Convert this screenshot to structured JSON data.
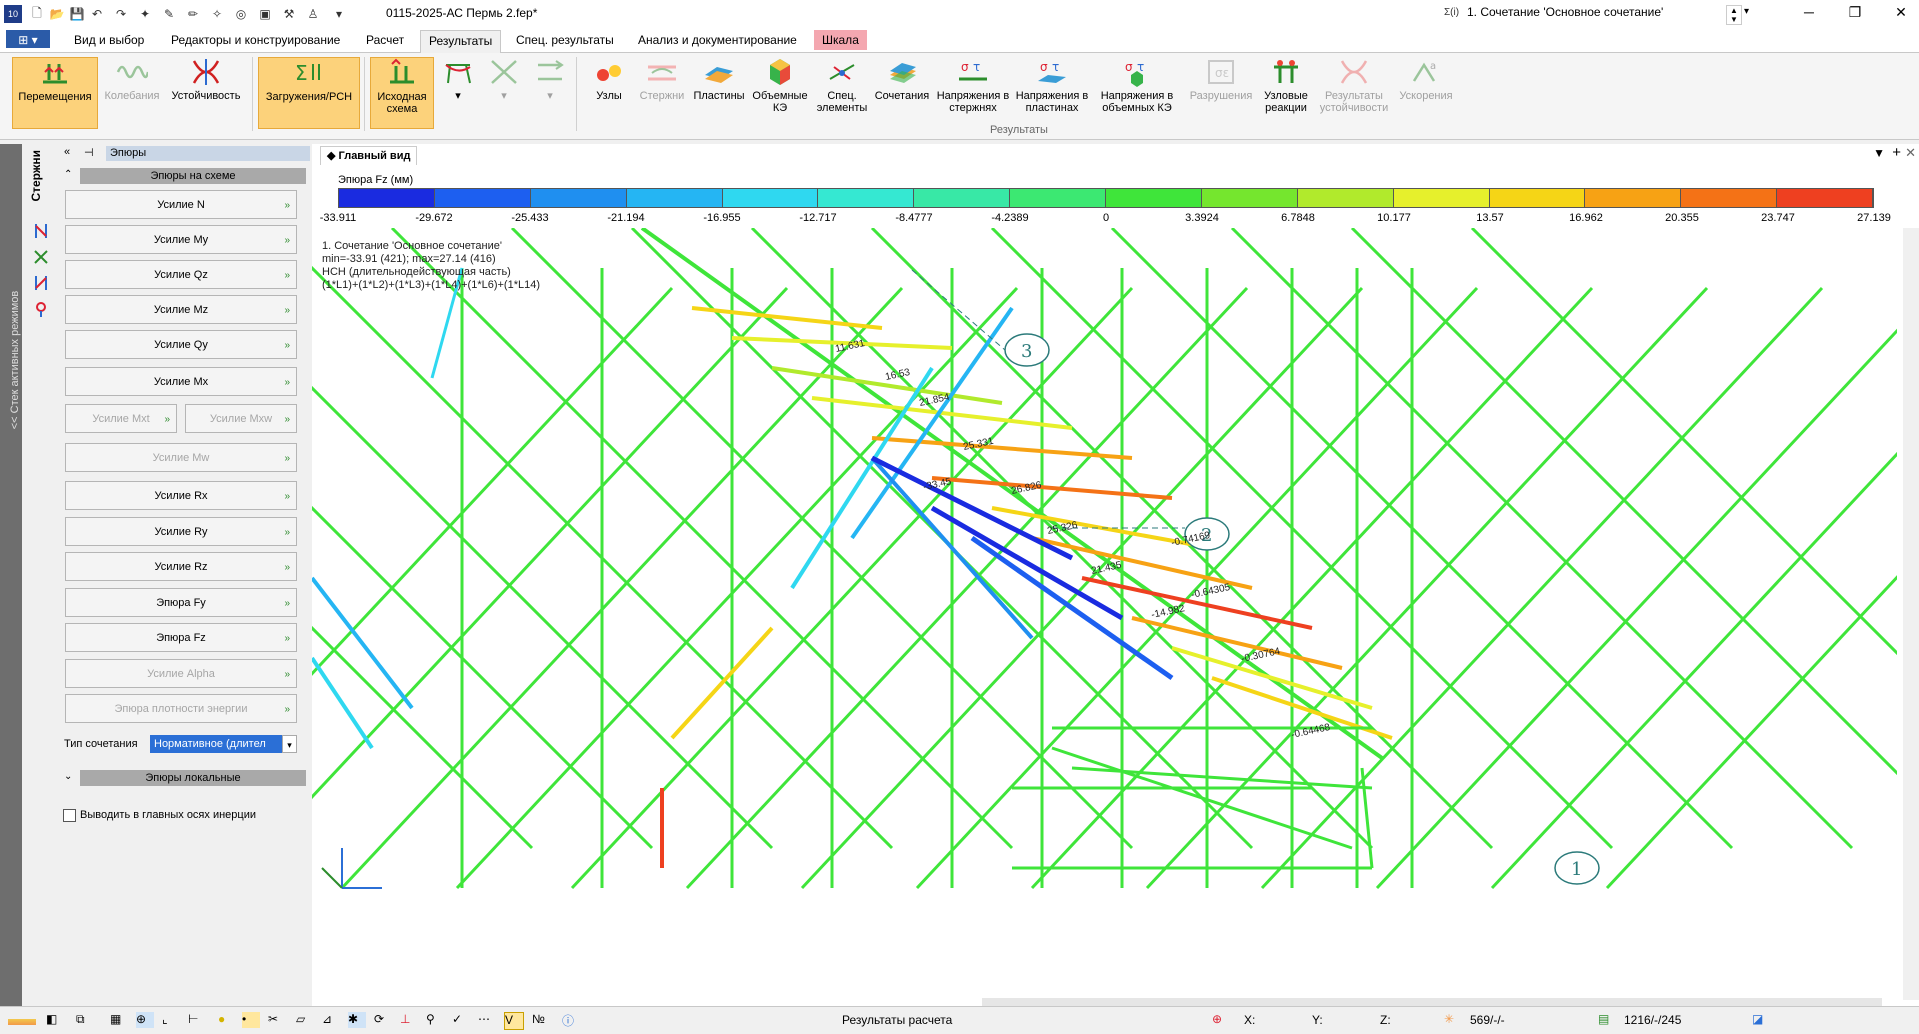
{
  "window": {
    "title": "0115-2025-АС Пермь 2.fep*",
    "combination": "1. Сочетание 'Основное сочетание'",
    "sigma_prefix": "Σ(i)"
  },
  "tabs": [
    "Вид и выбор",
    "Редакторы и конструирование",
    "Расчет",
    "Результаты",
    "Спец. результаты",
    "Анализ и документирование",
    "Шкала"
  ],
  "ribbon": {
    "group_label": "Результаты",
    "buttons": [
      {
        "label": "Перемещения",
        "state": "on"
      },
      {
        "label": "Колебания",
        "state": "dis"
      },
      {
        "label": "Устойчивость",
        "state": "en"
      },
      {
        "label": "Загружения/РСН",
        "state": "on"
      },
      {
        "label": "Исходная схема",
        "state": "on"
      },
      {
        "label": "Узлы",
        "state": "en"
      },
      {
        "label": "Стержни",
        "state": "dis"
      },
      {
        "label": "Пластины",
        "state": "en"
      },
      {
        "label": "Объемные КЭ",
        "state": "en"
      },
      {
        "label": "Спец. элементы",
        "state": "en"
      },
      {
        "label": "Сочетания",
        "state": "en"
      },
      {
        "label": "Напряжения в стержнях",
        "state": "en"
      },
      {
        "label": "Напряжения в пластинах",
        "state": "en"
      },
      {
        "label": "Напряжения в объемных КЭ",
        "state": "en"
      },
      {
        "label": "Разрушения",
        "state": "dis"
      },
      {
        "label": "Узловые реакции",
        "state": "en"
      },
      {
        "label": "Результаты устойчивости",
        "state": "dis"
      },
      {
        "label": "Ускорения",
        "state": "dis"
      }
    ]
  },
  "side_strip": {
    "text": "<< Стек активных режимов",
    "tool_label": "Стержни"
  },
  "panel": {
    "crumb": "Эпюры",
    "section_scheme": "Эпюры на схеме",
    "buttons": {
      "n": "Усилие N",
      "my": "Усилие My",
      "qz": "Усилие Qz",
      "mz": "Усилие Mz",
      "qy": "Усилие Qy",
      "mx": "Усилие Mx",
      "mxt": "Усилие Mxt",
      "mxw": "Усилие Mxw",
      "mw": "Усилие Mw",
      "rx": "Усилие Rx",
      "ry": "Усилие Ry",
      "rz": "Усилие Rz",
      "fy": "Эпюра Fy",
      "fz": "Эпюра Fz",
      "alpha": "Усилие Alpha",
      "energy": "Эпюра плотности энергии"
    },
    "arrow": "»",
    "combo_label": "Тип сочетания",
    "combo_value": "Нормативное (длител",
    "section_local": "Эпюры локальные",
    "checkbox_label": "Выводить в главных осях инерции"
  },
  "view": {
    "tab": "Главный вид",
    "legend_title": "Эпюра Fz (мм)",
    "scale_ticks": [
      "-33.911",
      "-29.672",
      "-25.433",
      "-21.194",
      "-16.955",
      "-12.717",
      "-8.4777",
      "-4.2389",
      "0",
      "3.3924",
      "6.7848",
      "10.177",
      "13.57",
      "16.962",
      "20.355",
      "23.747",
      "27.139"
    ],
    "scale_colors": [
      "#1a2be0",
      "#1d5ff0",
      "#1f8ff0",
      "#25b5f3",
      "#2fd8f0",
      "#35e8d2",
      "#38e8a6",
      "#3ce872",
      "#3fe53a",
      "#75e62e",
      "#b1ea2c",
      "#e6f02c",
      "#f5d516",
      "#f7a214",
      "#f47216",
      "#ee4020"
    ],
    "info_lines": [
      "1. Сочетание 'Основное сочетание'",
      "min=-33.91 (421); max=27.14 (416)",
      "НСН (длительнодействующая часть)",
      "(1*L1)+(1*L2)+(1*L3)+(1*L4)+(1*L6)+(1*L14)"
    ],
    "axes": [
      "3",
      "2",
      "1"
    ],
    "member_labels": [
      "11.631",
      "16.53",
      "21.854",
      "25.331",
      "26.826",
      "25.326",
      "21.435",
      "-14.982",
      "-33.45",
      "-0.74169",
      "-0.64305",
      "-0.30764",
      "-0.64468"
    ]
  },
  "statusbar": {
    "center": "Результаты расчета",
    "x_label": "X:",
    "y_label": "Y:",
    "z_label": "Z:",
    "nodes": "569/-/-",
    "elements": "1216/-/245"
  }
}
